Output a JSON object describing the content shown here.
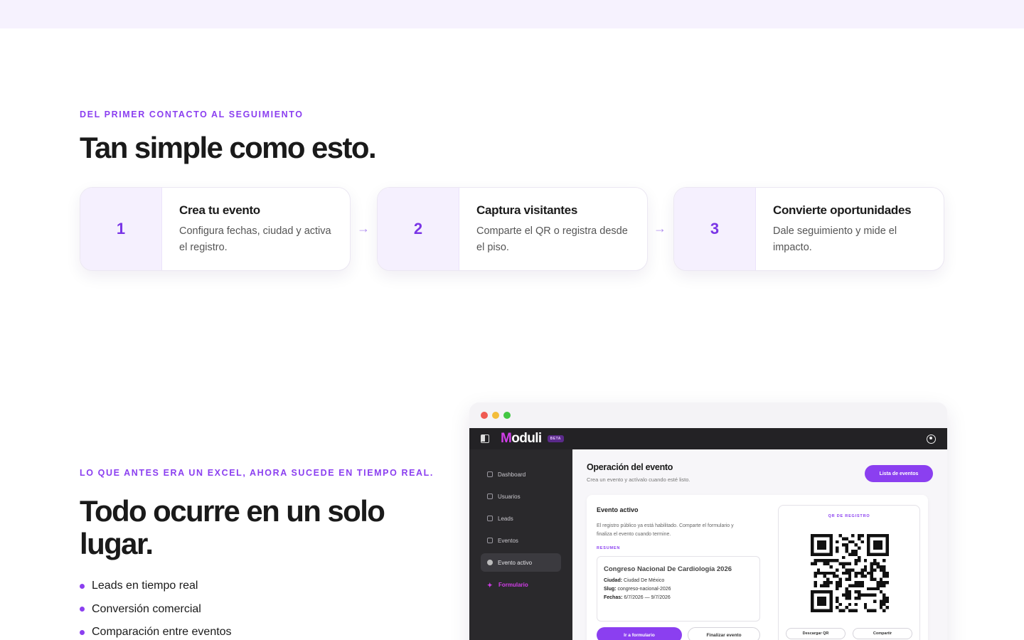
{
  "section1": {
    "eyebrow": "DEL PRIMER CONTACTO AL SEGUIMIENTO",
    "title": "Tan simple como esto.",
    "arrow": "→",
    "steps": [
      {
        "number": "1",
        "title": "Crea tu evento",
        "desc": "Configura fechas, ciudad y activa el registro."
      },
      {
        "number": "2",
        "title": "Captura visitantes",
        "desc": "Comparte el QR o registra desde el piso."
      },
      {
        "number": "3",
        "title": "Convierte oportunidades",
        "desc": "Dale seguimiento y mide el impacto."
      }
    ]
  },
  "section2": {
    "eyebrow": "LO QUE ANTES ERA UN EXCEL, AHORA SUCEDE EN TIEMPO REAL.",
    "title": "Todo ocurre en un solo lugar.",
    "bullets": [
      "Leads en tiempo real",
      "Conversión comercial",
      "Comparación entre eventos"
    ]
  },
  "app": {
    "brand_m": "M",
    "brand_rest": "oduli",
    "beta": "BETA",
    "sidebar": [
      "Dashboard",
      "Usuarios",
      "Leads",
      "Eventos",
      "Evento activo",
      "Formulario"
    ],
    "main_title": "Operación del evento",
    "main_sub": "Crea un evento y actívalo cuando esté listo.",
    "list_button": "Lista de eventos",
    "active_title": "Evento activo",
    "active_desc": "El registro público ya está habilitado. Comparte el formulario y finaliza el evento cuando termine.",
    "resumen_label": "RESUMEN",
    "event_name": "Congreso Nacional De Cardiología 2026",
    "city_label": "Ciudad:",
    "city": "Ciudad De México",
    "slug_label": "Slug:",
    "slug": "congreso-nacional-2026",
    "dates_label": "Fechas:",
    "dates": "6/7/2026 — 9/7/2026",
    "go_form": "Ir a formulario",
    "finish": "Finalizar evento",
    "qr_label": "QR DE REGISTRO",
    "download_qr": "Descargar QR",
    "share": "Compartir"
  },
  "colors": {
    "accent": "#8b3ff0",
    "brand_magenta": "#d13ee8",
    "dark": "#232225"
  }
}
